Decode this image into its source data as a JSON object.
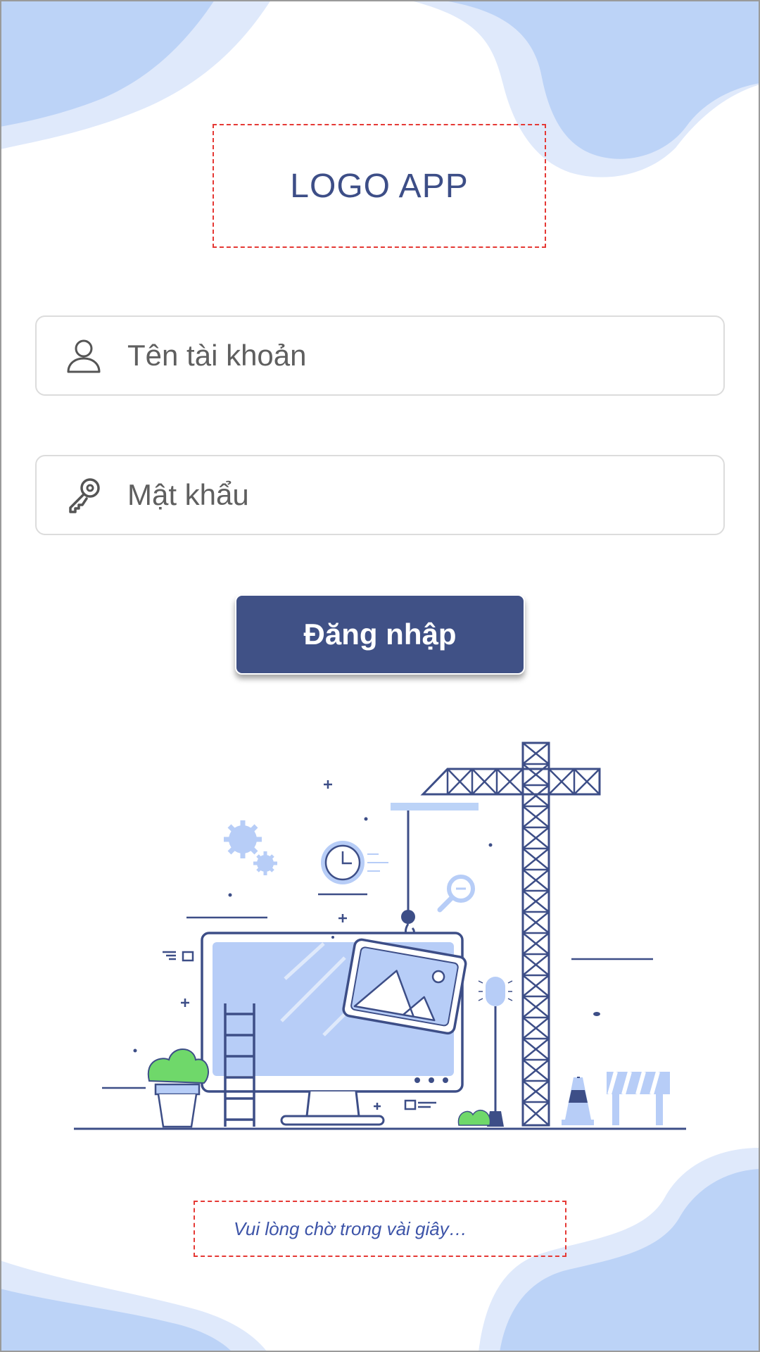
{
  "logo": {
    "text": "LOGO APP"
  },
  "username": {
    "placeholder": "Tên tài khoản",
    "value": "",
    "icon": "user-icon"
  },
  "password": {
    "placeholder": "Mật khẩu",
    "value": "",
    "icon": "key-icon"
  },
  "login_button": {
    "label": "Đăng nhập"
  },
  "status": {
    "text": "Vui lòng chờ trong vài giây…"
  },
  "colors": {
    "primary": "#405186",
    "blob_light": "#dfe9fb",
    "blob_mid": "#bcd3f7",
    "accent_green": "#6fd86a",
    "dashed_border": "#e53935"
  }
}
